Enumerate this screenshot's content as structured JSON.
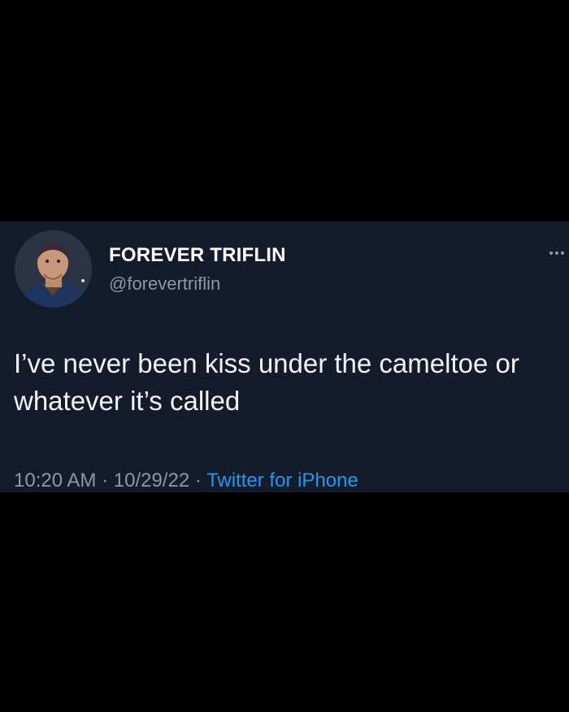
{
  "tweet": {
    "display_name": "FOREVER TRIFLIN",
    "handle": "@forevertriflin",
    "text": "I’ve never been kiss under the cameltoe or whatever it’s called",
    "time": "10:20 AM",
    "separator": "·",
    "date": "10/29/22",
    "source": "Twitter for iPhone"
  },
  "icons": {
    "avatar": "buzz-lightyear-avatar",
    "more": "more-options-icon"
  },
  "colors": {
    "background": "#000000",
    "card": "#141c2b",
    "secondary_text": "#8b98a5",
    "link": "#1d9bf0"
  }
}
